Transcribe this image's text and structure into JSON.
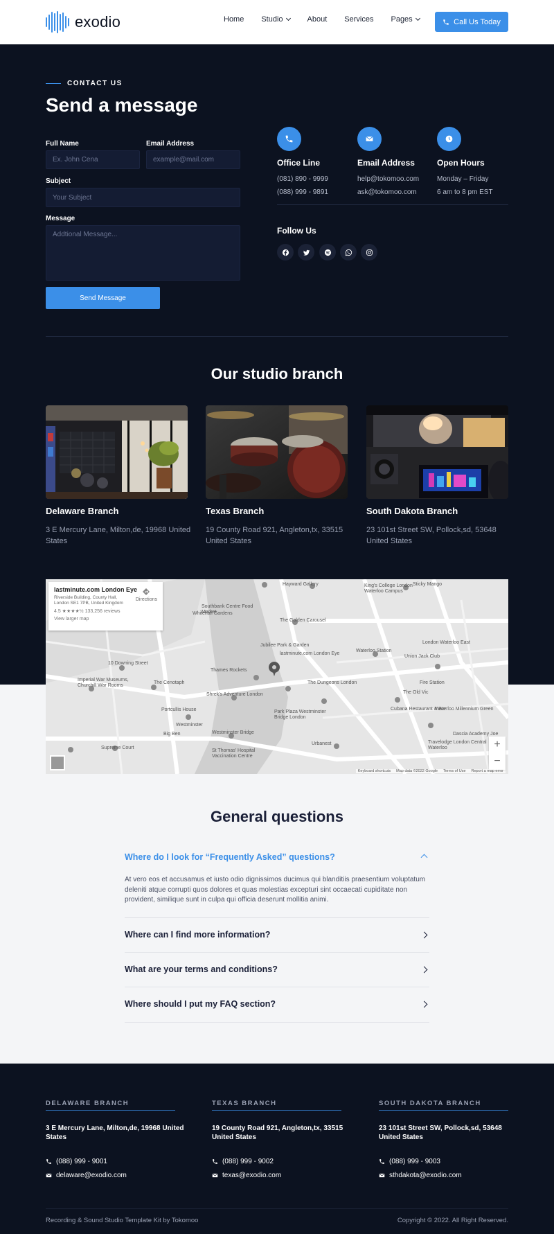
{
  "header": {
    "logo_text": "exodio",
    "nav": [
      {
        "label": "Home",
        "dropdown": false
      },
      {
        "label": "Studio",
        "dropdown": true
      },
      {
        "label": "About",
        "dropdown": false
      },
      {
        "label": "Services",
        "dropdown": false
      },
      {
        "label": "Pages",
        "dropdown": true
      }
    ],
    "cta_label": "Call Us Today"
  },
  "contact": {
    "eyebrow": "CONTACT US",
    "title": "Send a message",
    "form": {
      "full_name_label": "Full Name",
      "full_name_placeholder": "Ex. John Cena",
      "email_label": "Email Address",
      "email_placeholder": "example@mail.com",
      "subject_label": "Subject",
      "subject_placeholder": "Your Subject",
      "message_label": "Message",
      "message_placeholder": "Addtional Message...",
      "submit_label": "Send Message"
    },
    "info": [
      {
        "icon": "phone-icon",
        "title": "Office Line",
        "lines": [
          "(081) 890 - 9999",
          "(088) 999 - 9891"
        ]
      },
      {
        "icon": "envelope-icon",
        "title": "Email Address",
        "lines": [
          "help@tokomoo.com",
          "ask@tokomoo.com"
        ]
      },
      {
        "icon": "clock-icon",
        "title": "Open Hours",
        "lines": [
          "Monday – Friday",
          "6 am to 8 pm EST"
        ]
      }
    ],
    "follow_title": "Follow Us",
    "socials": [
      "facebook-icon",
      "twitter-icon",
      "spotify-icon",
      "whatsapp-icon",
      "instagram-icon"
    ]
  },
  "branches": {
    "title": "Our studio branch",
    "items": [
      {
        "name": "Delaware Branch",
        "address": "3 E Mercury Lane, Milton,de, 19968 United States"
      },
      {
        "name": "Texas Branch",
        "address": "19 County Road 921, Angleton,tx, 33515 United States"
      },
      {
        "name": "South Dakota Branch",
        "address": "23 101st Street SW, Pollock,sd, 53648 United States"
      }
    ]
  },
  "map": {
    "place_title": "lastminute.com London Eye",
    "place_address": "Riverside Building, County Hall, London SE1 7PB, United Kingdom",
    "rating": "4.5 ★★★★½",
    "reviews": "133,256 reviews",
    "larger_map": "View larger map",
    "directions": "Directions",
    "labels": [
      "King's College London Waterloo Campus",
      "Southbank Centre Food Market",
      "The Golden Carousel",
      "Thames Rockets",
      "lastminute.com London Eye",
      "The Dungeons London",
      "Waterloo Station",
      "Imperial War Museums, Churchill War Rooms",
      "The Cenotaph",
      "Shrek's Adventure London",
      "Portcullis House",
      "Westminster",
      "Big Ben",
      "Westminster Bridge",
      "Park Plaza Westminster Bridge London",
      "Urbanest",
      "The Old Vic",
      "Union Jack Club",
      "London Waterloo East",
      "Fire Station",
      "Cubana Restaurant & Bar",
      "Waterloo Millennium Green",
      "10 Downing Street",
      "Whitehall Gardens",
      "Jubilee Park & Garden",
      "Hayward Gallery",
      "Sticky Mango",
      "St Thomas' Hospital Vaccination Centre",
      "Supreme Court",
      "Travelodge London Central Waterloo",
      "Dascia Academy Joe"
    ],
    "footer": [
      "Keyboard shortcuts",
      "Map data ©2022 Google",
      "Terms of Use",
      "Report a map error"
    ]
  },
  "faq": {
    "title": "General questions",
    "items": [
      {
        "q": "Where do I look for “Frequently Asked” questions?",
        "open": true
      },
      {
        "q": "Where can I find more information?",
        "open": false
      },
      {
        "q": "What are your terms and conditions?",
        "open": false
      },
      {
        "q": "Where should I put my FAQ section?",
        "open": false
      }
    ],
    "answer": "At vero eos et accusamus et iusto odio dignissimos ducimus qui blanditiis praesentium voluptatum deleniti atque corrupti quos dolores et quas molestias excepturi sint occaecati cupiditate non provident, similique sunt in culpa qui officia deserunt mollitia animi."
  },
  "footer": {
    "branches": [
      {
        "head": "DELAWARE BRANCH",
        "address": "3 E Mercury Lane, Milton,de, 19968 United States",
        "phone": "(088) 999 - 9001",
        "email": "delaware@exodio.com"
      },
      {
        "head": "TEXAS BRANCH",
        "address": "19 County Road 921, Angleton,tx, 33515 United States",
        "phone": "(088) 999 - 9002",
        "email": "texas@exodio.com"
      },
      {
        "head": "SOUTH DAKOTA BRANCH",
        "address": "23 101st Street SW, Pollock,sd, 53648 United States",
        "phone": "(088) 999 - 9003",
        "email": "sthdakota@exodio.com"
      }
    ],
    "credit": "Recording & Sound Studio Template Kit by Tokomoo",
    "copyright": "Copyright © 2022. All Right Reserved."
  },
  "colors": {
    "accent": "#3b8fe8",
    "dark_bg": "#0c1220",
    "light_bg": "#f4f5f7",
    "heading_dark": "#1b2038"
  }
}
